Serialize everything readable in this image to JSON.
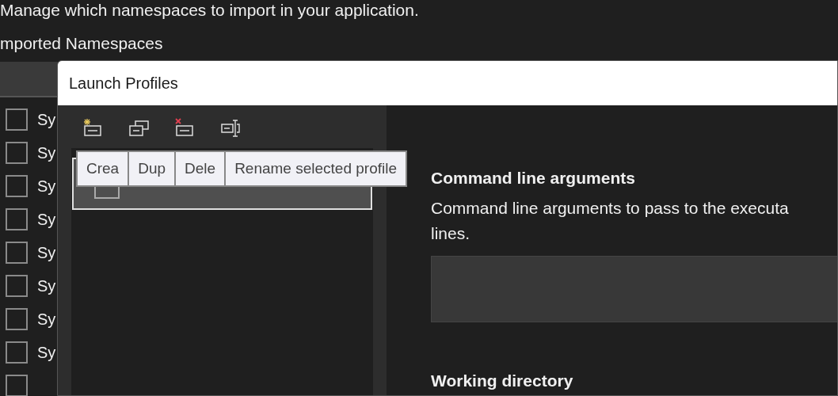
{
  "page": {
    "description": "Manage which namespaces to import in your application.",
    "section_title": "mported Namespaces"
  },
  "namespaces": [
    {
      "label": "Sy",
      "checked": false
    },
    {
      "label": "Sy",
      "checked": false
    },
    {
      "label": "Sy",
      "checked": false
    },
    {
      "label": "Sy",
      "checked": false
    },
    {
      "label": "Sy",
      "checked": false
    },
    {
      "label": "Sy",
      "checked": false
    },
    {
      "label": "Sy",
      "checked": false
    },
    {
      "label": "Sy",
      "checked": false
    },
    {
      "checked": false
    }
  ],
  "dialog": {
    "title": "Launch Profiles",
    "toolbar": [
      {
        "kind": "create"
      },
      {
        "kind": "duplicate"
      },
      {
        "kind": "delete"
      },
      {
        "kind": "rename"
      }
    ],
    "tooltips": [
      "Crea",
      "Dup",
      "Dele",
      "Rename selected profile"
    ],
    "profiles": [
      {
        "selected": true
      }
    ],
    "settings": {
      "heading": "Command line arguments",
      "description_lines": [
        "Command line arguments to pass to the executa",
        "lines."
      ],
      "second_heading": "Working directory"
    }
  }
}
